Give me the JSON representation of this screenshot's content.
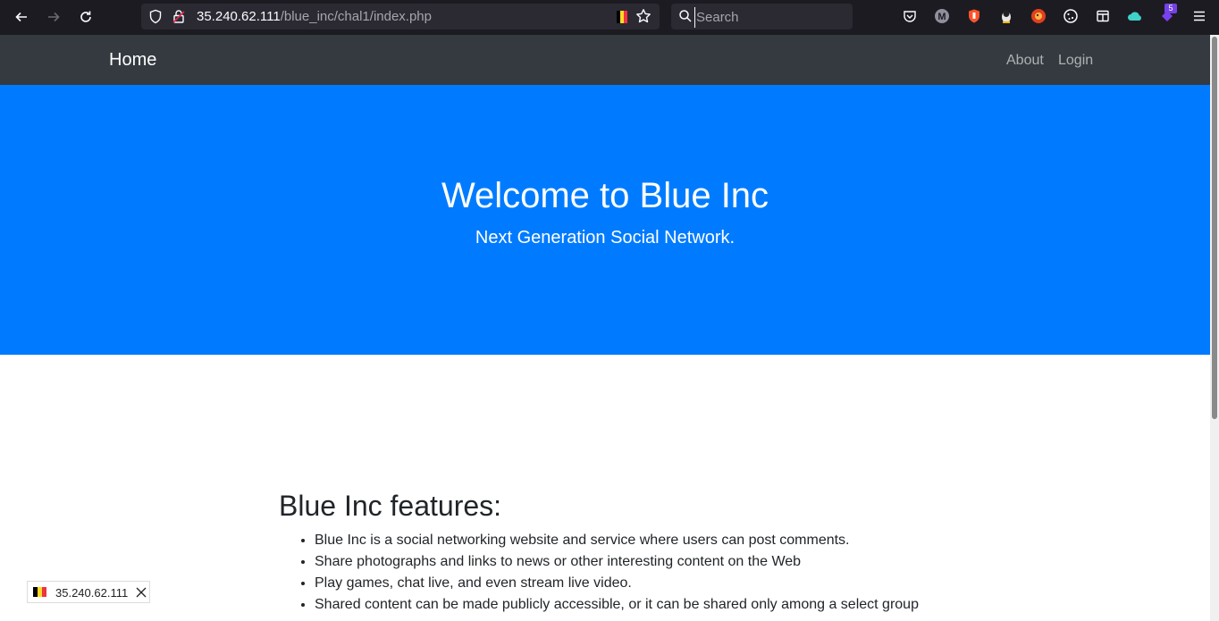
{
  "browser": {
    "url_host": "35.240.62.111",
    "url_path": "/blue_inc/chal1/index.php",
    "search_placeholder": "Search",
    "extension_badge": "5",
    "icons": [
      "back-icon",
      "forward-icon",
      "reload-icon",
      "shield-icon",
      "lock-icon",
      "star-icon",
      "search-icon",
      "pocket-icon",
      "extension-icons",
      "menu-icon"
    ],
    "flag_colors": [
      "#000000",
      "#fdda24",
      "#ef3340"
    ]
  },
  "navbar": {
    "brand": "Home",
    "links": [
      "About",
      "Login"
    ]
  },
  "hero": {
    "title": "Welcome to Blue Inc",
    "subtitle": "Next Generation Social Network.",
    "background": "#007bff"
  },
  "features": {
    "heading": "Blue Inc features:",
    "items": [
      "Blue Inc is a social networking website and service where users can post comments.",
      "Share photographs and links to news or other interesting content on the Web",
      "Play games, chat live, and even stream live video.",
      "Shared content can be made publicly accessible, or it can be shared only among a select group"
    ]
  },
  "status": {
    "text": "35.240.62.111"
  },
  "colors": {
    "navbar_bg": "#343a40",
    "hero_bg": "#007bff",
    "browser_bg": "#1c1b22"
  }
}
